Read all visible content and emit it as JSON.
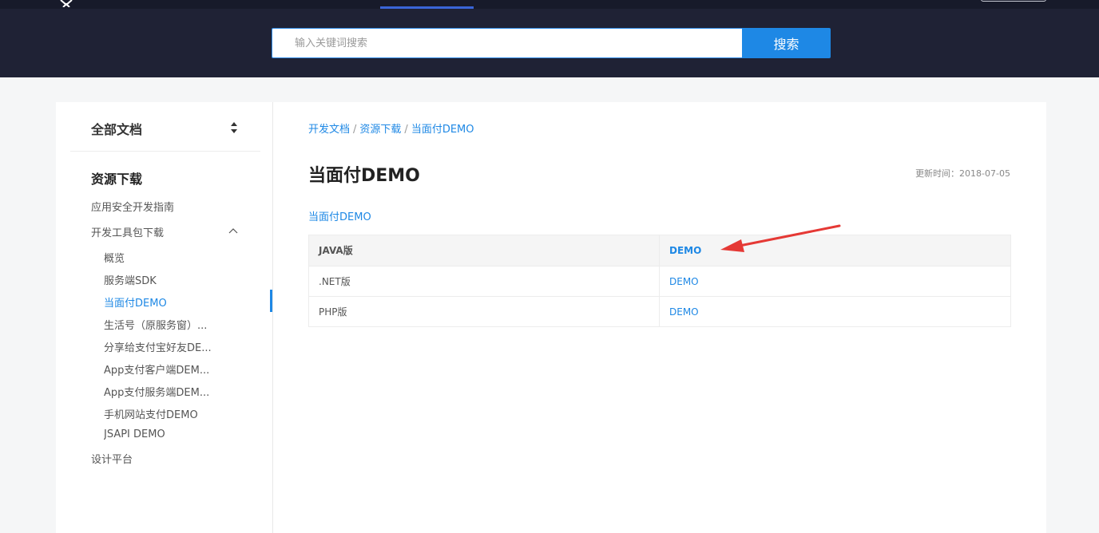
{
  "search": {
    "placeholder": "输入关键词搜索",
    "button_label": "搜索"
  },
  "sidebar": {
    "doc_selector_label": "全部文档",
    "section_title": "资源下载",
    "items": [
      {
        "label": "应用安全开发指南",
        "level": 1
      },
      {
        "label": "开发工具包下载",
        "level": 1,
        "expanded": true
      },
      {
        "label": "概览",
        "level": 2
      },
      {
        "label": "服务端SDK",
        "level": 2
      },
      {
        "label": "当面付DEMO",
        "level": 2,
        "active": true
      },
      {
        "label": "生活号（原服务窗）...",
        "level": 2
      },
      {
        "label": "分享给支付宝好友DE...",
        "level": 2
      },
      {
        "label": "App支付客户端DEM...",
        "level": 2
      },
      {
        "label": "App支付服务端DEM...",
        "level": 2
      },
      {
        "label": "手机网站支付DEMO",
        "level": 2
      },
      {
        "label": "JSAPI DEMO",
        "level": 2
      },
      {
        "label": "设计平台",
        "level": 1
      }
    ]
  },
  "breadcrumb": {
    "items": [
      "开发文档",
      "资源下载",
      "当面付DEMO"
    ],
    "separator": "/"
  },
  "main": {
    "title": "当面付DEMO",
    "updated_label": "更新时间：2018-07-05",
    "intro_link": "当面付DEMO",
    "table": {
      "rows": [
        {
          "name": "JAVA版",
          "link": "DEMO"
        },
        {
          "name": ".NET版",
          "link": "DEMO"
        },
        {
          "name": "PHP版",
          "link": "DEMO"
        }
      ]
    }
  },
  "colors": {
    "header_bg": "#1f2235",
    "accent": "#1e88e5",
    "annotation_arrow": "#e53935"
  }
}
